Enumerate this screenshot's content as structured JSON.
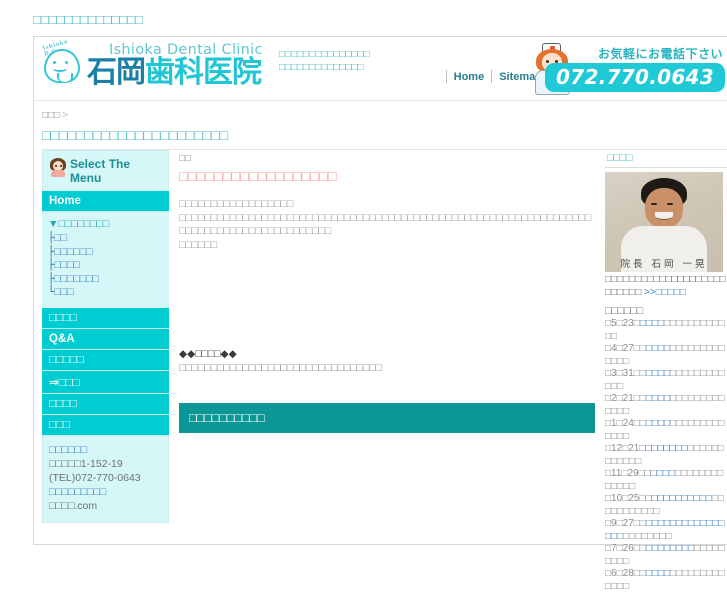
{
  "page": {
    "top_title": "□□□□□□□□□□□□□□",
    "breadcrumb_home": "□□□",
    "breadcrumb_sep": ">",
    "breadcrumb_current": "□□□□□□□□□□□□□□□□□□□□□□"
  },
  "header": {
    "logo_arc": "Ishioka D.C.",
    "logo_en": "Ishioka Dental Clinic",
    "logo_jp_dark": "石岡",
    "logo_jp_light": "歯科医院",
    "tagline_line1": "□□□□□□□□□□□□□□□",
    "tagline_line2": "□□□□□□□□□□□□□□",
    "link_home": "Home",
    "link_sitemap": "Sitemap",
    "call_note": "お気軽にお電話下さい",
    "phone": "072.770.0643",
    "nurse_icon": "nurse-illustration",
    "tooth_icon": "smiling-tooth-logo"
  },
  "sidebar": {
    "menu_title": "Select The Menu",
    "menu_icon": "girl-avatar-icon",
    "home_label": "Home",
    "submenu": {
      "header_marker": "▼",
      "header_label": "□□□□□□□□",
      "items": [
        {
          "tw": "├",
          "label": "□□"
        },
        {
          "tw": "├",
          "label": "□□□□□□"
        },
        {
          "tw": "├",
          "label": "□□□□"
        },
        {
          "tw": "├",
          "label": "□□□□□□□"
        },
        {
          "tw": "└",
          "label": "□□□"
        }
      ]
    },
    "nav_items": [
      {
        "label": "□□□□"
      },
      {
        "label": "Q&A"
      },
      {
        "label": "□□□□□"
      },
      {
        "label": "⇒□□□"
      },
      {
        "label": "□□□□"
      },
      {
        "label": "□□□"
      }
    ],
    "address": {
      "clinic_name": "□□□□□□",
      "street": "□□□□□1-152-19",
      "tel": "(TEL)072-770-0643",
      "site_label": "□□□□□□□□□",
      "site_url": "□□□□.com"
    }
  },
  "main": {
    "eyebrow": "□□",
    "title": "□□□□□□□□□□□□□□□□□□",
    "body_line1": "□□□□□□□□□□□□□□□□□□",
    "body_line2": "□□□□□□□□□□□□□□□□□□□□□□□□□□□□□□□□□□□□□□□□□□□□□□□□□□□□□□□□□□□□□□□□□□□□□□□□□□□□□□□□□□□□□□□□□",
    "body_line3": "□□□□□□",
    "mid_heading": "◆◆□□□□◆◆",
    "mid_text": "□□□□□□□□□□□□□□□□□□□□□□□□□□□□□□□□",
    "section_bar": "□□□□□□□□□□"
  },
  "right": {
    "header": "□□□□",
    "photo_caption": "院長 石岡 一晃",
    "photo_alt": "director-portrait",
    "doc_desc_line1": "□□□□□□□□□□□□□□□□□",
    "doc_desc_line2": "□□□□□□□□□",
    "doc_desc_arrow": ">>",
    "doc_desc_link": "□□□□□",
    "news_header": "□□□□□□",
    "news": [
      {
        "date": "□5□23□",
        "link": "□□□□",
        "rest": "□□□□□□□□□□□□"
      },
      {
        "date": "□4□27□□",
        "link": "□□□□",
        "rest": "□□□□□□□□□□□□□"
      },
      {
        "date": "□3□31□□",
        "link": "□□□□",
        "rest": "□□□□□□□□□□□□"
      },
      {
        "date": "□2□21□□",
        "link": "□□□□",
        "rest": "□□□□□□□□□□□□□"
      },
      {
        "date": "□1□24□□",
        "link": "□□□□",
        "rest": "□□□□□□□□□□□□□"
      },
      {
        "date": "□12□21□",
        "link": "□□□□□□□",
        "rest": "□□□□□□□□□□□□"
      },
      {
        "date": "□11□29□□",
        "link": "□□□□",
        "rest": "□□□□□□□□□□□□□"
      },
      {
        "date": "□10□25□□",
        "link": "□□□□□□□□□□",
        "rest": "□□□□□□□□□□□"
      },
      {
        "date": "□9□27□□",
        "link": "□□□□□□□□□□□□□□□",
        "rest": "□□□□□□□□□"
      },
      {
        "date": "□7□26□□",
        "link": "□□□□□□□□",
        "rest": "□□□□□□□□□"
      },
      {
        "date": "□6□28□□",
        "link": "□□□□",
        "rest": "□□□□□□□□□□□□□"
      }
    ]
  }
}
